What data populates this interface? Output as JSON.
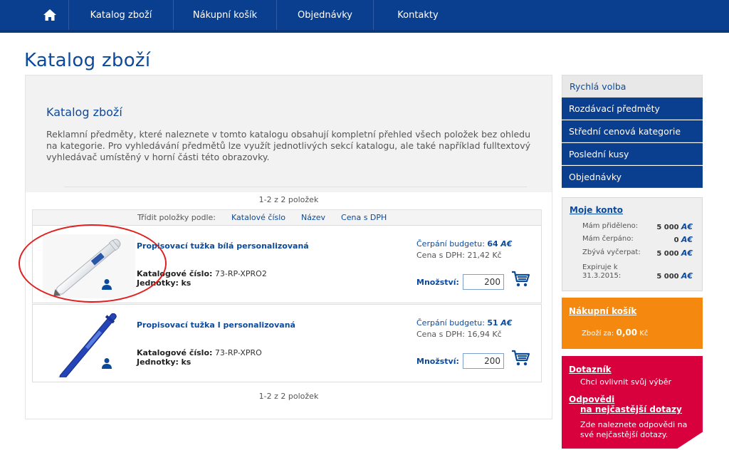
{
  "nav": {
    "items": [
      "Katalog zboží",
      "Nákupní košík",
      "Objednávky",
      "Kontakty"
    ]
  },
  "page": {
    "title": "Katalog zboží"
  },
  "content": {
    "title": "Katalog zboží",
    "description": "Reklamní předměty, které naleznete v tomto katalogu obsahují kompletní přehled všech položek bez ohledu na kategorie. Pro vyhledávání předmětů lze využít jednotlivých sekcí katalogu, ale také například fulltextový vyhledávač umístěný v horní části této obrazovky.",
    "pager_top": "1-2 z 2 položek",
    "pager_bottom": "1-2 z 2 položek"
  },
  "sort": {
    "label": "Třídit položky podle:",
    "options": [
      "Katalové číslo",
      "Název",
      "Cena s DPH"
    ]
  },
  "products": [
    {
      "name": "Propisovací tužka bílá personalizovaná",
      "code_label": "Katalogové číslo:",
      "code": "73-RP-XPRO2",
      "units_label": "Jednotky:",
      "units": "ks",
      "budget_label": "Čerpání budgetu:",
      "budget": "64",
      "price_label": "Cena s DPH:",
      "price": "21,42 Kč",
      "qty_label": "Množství:",
      "qty": "200"
    },
    {
      "name": "Propisovací tužka I personalizovaná",
      "code_label": "Katalogové číslo:",
      "code": "73-RP-XPRO",
      "units_label": "Jednotky:",
      "units": "ks",
      "budget_label": "Čerpání budgetu:",
      "budget": "51",
      "price_label": "Cena s DPH:",
      "price": "16,94 Kč",
      "qty_label": "Množství:",
      "qty": "200"
    }
  ],
  "sidebar": {
    "quick": "Rychlá volba",
    "items": [
      "Rozdávací předměty",
      "Střední cenová kategorie",
      "Poslední kusy",
      "Objednávky"
    ],
    "account": {
      "title": "Moje konto",
      "rows": [
        {
          "label": "Mám přiděleno:",
          "value": "5 000"
        },
        {
          "label": "Mám čerpáno:",
          "value": "0"
        },
        {
          "label": "Zbývá vyčerpat:",
          "value": "5 000"
        },
        {
          "label": "Expiruje k",
          "label2": "31.3.2015:",
          "value": "5 000"
        }
      ]
    },
    "cart": {
      "title": "Nákupní košík",
      "label": "Zboží za:",
      "value": "0,00",
      "currency": "Kč"
    },
    "faq": {
      "title1": "Dotazník",
      "text1": "Chci ovlivnit svůj výběr",
      "title2a": "Odpovědi",
      "title2b": "na nejčastější dotazy",
      "text2": "Zde naleznete odpovědi na své nejčastější dotazy."
    }
  },
  "colors": {
    "nav_blue": "#0a3e8e",
    "accent_blue": "#0b4a9b",
    "orange": "#f5890f",
    "crimson": "#d8003d",
    "annotation_red": "#e02020"
  }
}
